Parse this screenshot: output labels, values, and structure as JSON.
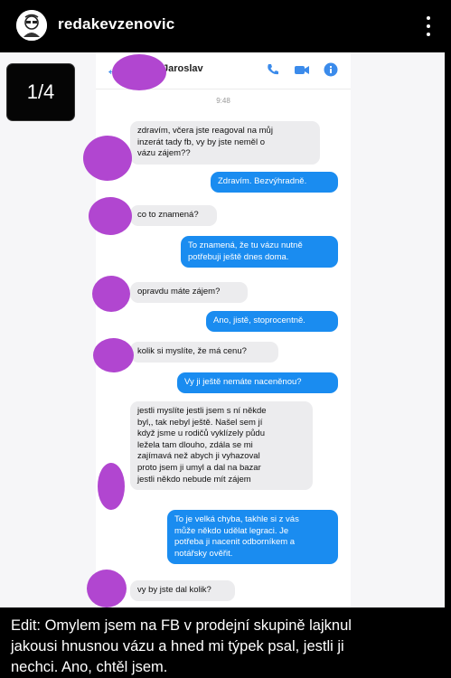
{
  "header": {
    "username": "redakevzenovic",
    "menu_icon": "more-vertical-icon"
  },
  "pager": {
    "label": "1/4"
  },
  "chat": {
    "contact_name": "Jaroslav",
    "time": "9:48",
    "icons": [
      "back-arrow-icon",
      "phone-icon",
      "video-camera-icon",
      "info-icon"
    ],
    "messages": [
      {
        "dir": "in",
        "lines": [
          "zdravím, včera jste reagoval na můj",
          "inzerát tady fb, vy by jste neměl o",
          "vázu zájem??"
        ]
      },
      {
        "dir": "out",
        "lines": [
          "Zdravím. Bezvýhradně."
        ]
      },
      {
        "dir": "in",
        "lines": [
          "co to znamená?"
        ]
      },
      {
        "dir": "out",
        "lines": [
          "To znamená, že tu vázu nutně",
          "potřebuji ještě dnes doma."
        ]
      },
      {
        "dir": "in",
        "lines": [
          "opravdu máte zájem?"
        ]
      },
      {
        "dir": "out",
        "lines": [
          "Ano, jistě, stoprocentně."
        ]
      },
      {
        "dir": "in",
        "lines": [
          "kolik si myslíte, že má cenu?"
        ]
      },
      {
        "dir": "out",
        "lines": [
          "Vy ji ještě nemáte naceněnou?"
        ]
      },
      {
        "dir": "in",
        "lines": [
          "jestli myslíte jestli jsem s ní někde",
          "byl,, tak nebyl ještě. Našel sem jí",
          "když jsme u rodičů vyklízely půdu",
          "ležela tam dlouho, zdála se mi",
          "zajímavá než abych ji vyhazoval",
          "proto jsem ji umyl a dal na bazar",
          "jestli někdo nebude mít zájem"
        ]
      },
      {
        "dir": "out",
        "lines": [
          "To je velká chyba, takhle si z vás",
          "může někdo udělat legraci. Je",
          "potřeba ji nacenit odborníkem a",
          "notářsky ověřit."
        ]
      },
      {
        "dir": "in",
        "lines": [
          "vy by jste dal kolik?"
        ]
      }
    ]
  },
  "caption": {
    "lines": [
      "Edit: Omylem jsem na FB v prodejní skupině lajknul",
      "jakousi hnusnou vázu a hned mi týpek psal, jestli ji",
      "nechci. Ano, chtěl jsem."
    ]
  },
  "colors": {
    "outgoing_bubble": "#1a8cf0",
    "incoming_bubble": "#ececee",
    "redaction": "#b146d0",
    "messenger_blue": "#3b8beb"
  }
}
